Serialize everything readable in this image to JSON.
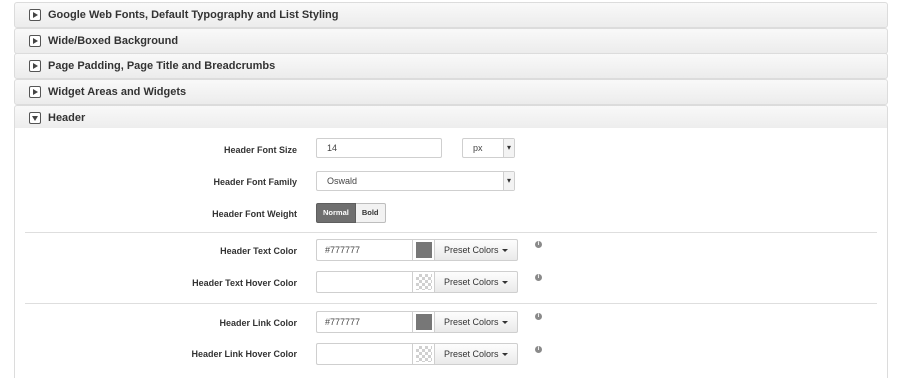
{
  "sections": [
    {
      "title": "Google Web Fonts, Default Typography and List Styling",
      "state": "collapsed"
    },
    {
      "title": "Wide/Boxed Background",
      "state": "collapsed"
    },
    {
      "title": "Page Padding, Page Title and Breadcrumbs",
      "state": "collapsed"
    },
    {
      "title": "Widget Areas and Widgets",
      "state": "collapsed"
    },
    {
      "title": "Header",
      "state": "expanded"
    }
  ],
  "header_panel": {
    "font_size": {
      "label": "Header Font Size",
      "value": "14",
      "unit": "px"
    },
    "font_family": {
      "label": "Header Font Family",
      "value": "Oswald"
    },
    "font_weight": {
      "label": "Header Font Weight",
      "options": [
        "Normal",
        "Bold"
      ],
      "selected": "Normal"
    },
    "text_color": {
      "label": "Header Text Color",
      "value": "#777777",
      "swatch": "#777777",
      "preset_label": "Preset Colors",
      "info": "i"
    },
    "text_hover_color": {
      "label": "Header Text Hover Color",
      "value": "",
      "preset_label": "Preset Colors",
      "info": "i"
    },
    "link_color": {
      "label": "Header Link Color",
      "value": "#777777",
      "swatch": "#777777",
      "preset_label": "Preset Colors",
      "info": "i"
    },
    "link_hover_color": {
      "label": "Header Link Hover Color",
      "value": "",
      "preset_label": "Preset Colors",
      "info": "i"
    }
  }
}
